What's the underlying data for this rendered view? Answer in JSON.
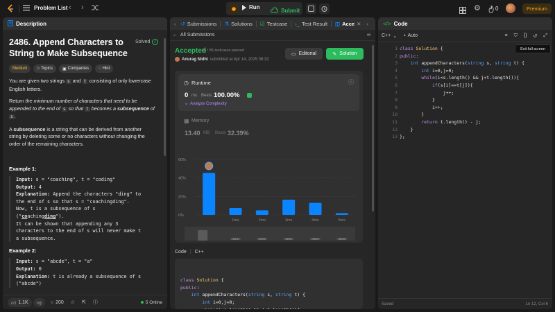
{
  "topbar": {
    "problem_list": "Problem List",
    "run": "Run",
    "submit": "Submit",
    "streak": "0",
    "premium": "Premium"
  },
  "left": {
    "header": "Description",
    "title_line1": "2486. Append Characters to",
    "title_line2": "String to Make Subsequence",
    "solved": "Solved",
    "tags": [
      "Medium",
      "Topics",
      "Companies",
      "Hint"
    ],
    "p1_a": "You are given two strings",
    "p1_s": "s",
    "p1_and": "and",
    "p1_t": "t",
    "p1_b": "consisting of only lowercase",
    "p1_c": "English letters.",
    "p2_a": "Return",
    "p2_b": "the minimum number of characters that need to be",
    "p2_c": "appended to the end of",
    "p2_s": "s",
    "p2_d": "so that",
    "p2_t": "t",
    "p2_e": "becomes a",
    "p2_f": "subsequence",
    "p2_g": "of",
    "p2_s2": "s",
    "p3_a": "subsequence",
    "p3_b": "is a string that can be derived from another",
    "p3_c": "string by deleting some or no characters without changing the",
    "p3_d": "order of the remaining characters.",
    "p3_A": "A",
    "ex1_title": "Example 1:",
    "ex1_input_label": "Input:",
    "ex1_input": "s = \"coaching\", t = \"coding\"",
    "ex1_output_label": "Output:",
    "ex1_output": "4",
    "ex1_expl_label": "Explanation:",
    "ex1_expl1": "Append the characters \"ding\" to",
    "ex1_expl2": "the end of s so that s = \"coachingding\".",
    "ex1_expl3": "Now, t is a subsequence of s",
    "ex1_expl4a": "(\"",
    "ex1_expl4b": "co",
    "ex1_expl4c": "aching",
    "ex1_expl4d": "ding",
    "ex1_expl4e": "\").",
    "ex1_expl5": "It can be shown that appending any 3",
    "ex1_expl6": "characters to the end of s will never make t",
    "ex1_expl7": "a subsequence.",
    "ex2_title": "Example 2:",
    "ex2_input": "s = \"abcde\", t = \"a\"",
    "ex2_output": "0",
    "ex2_expl1": "t is already a subsequence of s",
    "ex2_expl2": "(\"abcde\")",
    "likes": "1.1K",
    "comments": "200",
    "online": "5 Online"
  },
  "mid": {
    "tabs": [
      "Submissions",
      "Solutions",
      "Testcase",
      "Test Result",
      "Acce"
    ],
    "all_submissions": "All Submissions",
    "accepted": "Accepted",
    "passed": "86 / 86 testcases passed",
    "author": "Anurag Nidhi",
    "submitted_at": "submitted at Apr 14, 2025 08:32",
    "editorial": "Editorial",
    "solution": "Solution",
    "runtime_label": "Runtime",
    "runtime_value": "0",
    "runtime_unit": "ms",
    "beats": "Beats",
    "runtime_beats": "100.00%",
    "analyze": "Analyze Complexity",
    "memory_label": "Memory",
    "memory_value": "13.40",
    "memory_unit": "MB",
    "memory_beats": "32.39%",
    "code_label": "Code",
    "code_lang": "C++"
  },
  "chart_data": {
    "type": "bar",
    "categories": [
      "0ms",
      "1ms",
      "2ms",
      "3ms",
      "4ms",
      "5ms"
    ],
    "x_tick_labels": [
      "",
      "1ms",
      "2ms",
      "3ms",
      "4ms",
      "5ms"
    ],
    "values": [
      45.5,
      7.5,
      5,
      16.5,
      13,
      2
    ],
    "yticks": [
      "60%",
      "40%",
      "20%",
      "0%"
    ],
    "ylim": [
      0,
      60
    ],
    "minimap_labels": [
      "1ms",
      "2ms",
      "3ms",
      "4ms",
      "5ms"
    ],
    "color": "#0a84ff"
  },
  "right": {
    "header": "Code",
    "lang": "C++",
    "mode": "Auto",
    "tooltip": "Exit full screen",
    "lines": [
      "class Solution {",
      "public:",
      "    int appendCharacters(string s, string t) {",
      "        int i=0,j=0;",
      "        while(i<s.length() && j<t.length()){",
      "            if(s[i]==t[j]){",
      "                j++;",
      "            }",
      "            i++;",
      "        }",
      "        return t.length() - j;",
      "    }",
      "};"
    ],
    "line_numbers": [
      "1",
      "2",
      "3",
      "4",
      "5",
      "6",
      "7",
      "8",
      "9",
      "10",
      "11",
      "12",
      "13"
    ],
    "saved": "Saved",
    "cursor": "Ln 12, Col 6"
  },
  "mid_code": [
    "class Solution {",
    "public:",
    "    int appendCharacters(string s, string t) {",
    "        int i=0,j=0;",
    "        while(i<s.length() && j<t.length()){",
    "            if(s[i]==t[j]){"
  ]
}
